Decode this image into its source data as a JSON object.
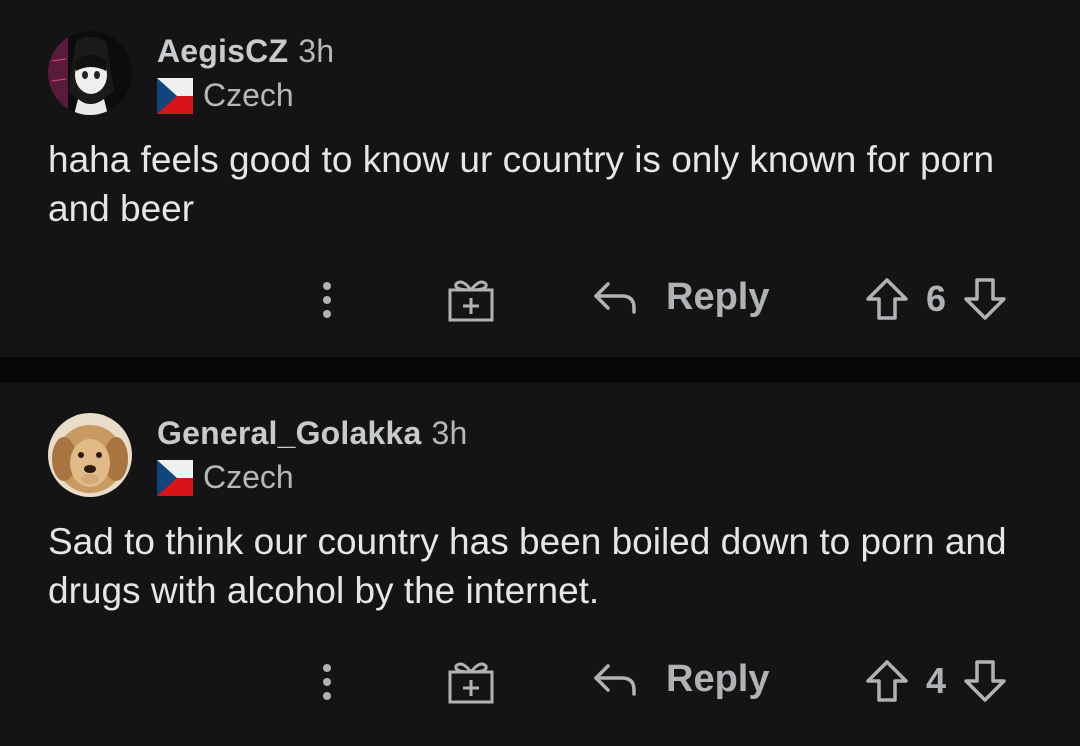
{
  "comments": [
    {
      "username": "AegisCZ",
      "time": "3h",
      "flair": "Czech",
      "body": "haha feels good to know ur country is only known for porn and beer",
      "reply_label": "Reply",
      "score": "6"
    },
    {
      "username": "General_Golakka",
      "time": "3h",
      "flair": "Czech",
      "body": "Sad to think our country has been boiled down to porn and drugs with alcohol by the internet.",
      "reply_label": "Reply",
      "score": "4"
    }
  ],
  "icons": {
    "more": "more-vertical-icon",
    "award": "gift-award-icon",
    "reply": "reply-arrow-icon",
    "upvote": "upvote-arrow-icon",
    "downvote": "downvote-arrow-icon",
    "flag": "czech-flag-icon"
  },
  "colors": {
    "background": "#141414",
    "separator": "#070707",
    "text": "#e4e6e8",
    "muted": "#b0b3b6"
  }
}
